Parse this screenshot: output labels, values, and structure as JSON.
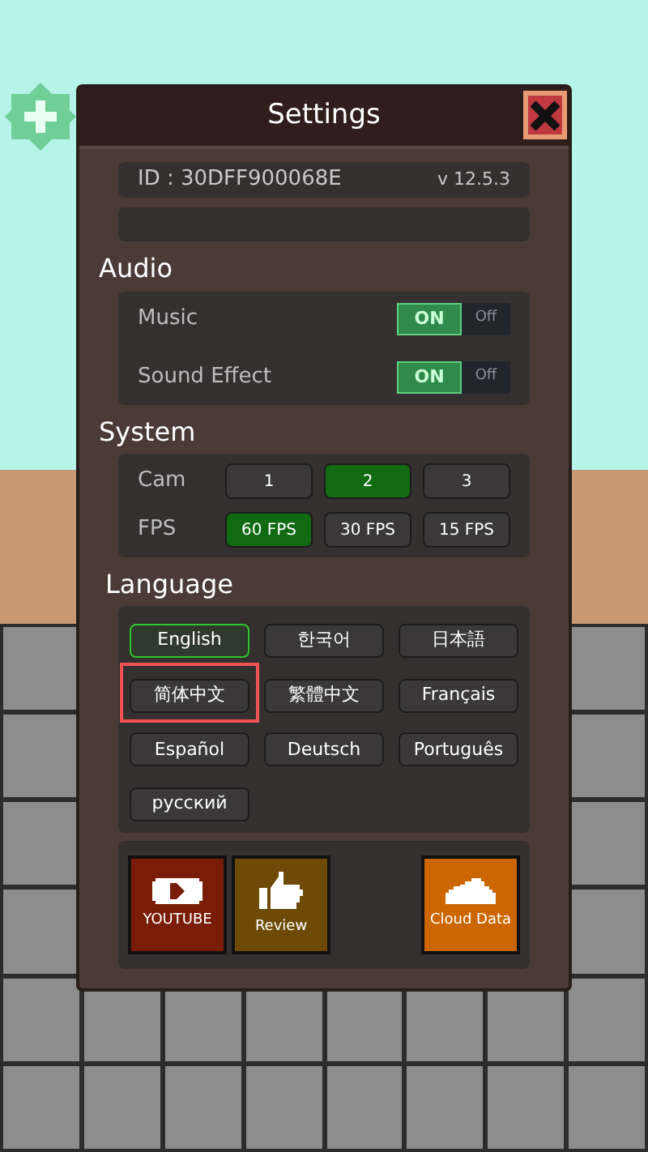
{
  "window": {
    "title": "Settings"
  },
  "account": {
    "id": "ID : 30DFF900068E",
    "version": "v 12.5.3"
  },
  "audio": {
    "heading": "Audio",
    "toggles": [
      {
        "label": "Music",
        "on": true,
        "on_text": "ON",
        "off_text": "Off"
      },
      {
        "label": "Sound Effect",
        "on": true,
        "on_text": "ON",
        "off_text": "Off"
      }
    ]
  },
  "system": {
    "heading": "System",
    "rows": [
      {
        "label": "Cam",
        "options": [
          {
            "label": "1",
            "selected": false
          },
          {
            "label": "2",
            "selected": true
          },
          {
            "label": "3",
            "selected": false
          }
        ]
      },
      {
        "label": "FPS",
        "options": [
          {
            "label": "60 FPS",
            "selected": true
          },
          {
            "label": "30 FPS",
            "selected": false
          },
          {
            "label": "15 FPS",
            "selected": false
          }
        ]
      }
    ]
  },
  "language": {
    "heading": "Language",
    "options": [
      {
        "label": "English",
        "selected": true,
        "highlighted": false
      },
      {
        "label": "한국어",
        "selected": false,
        "highlighted": false
      },
      {
        "label": "日本語",
        "selected": false,
        "highlighted": false
      },
      {
        "label": "简体中文",
        "selected": false,
        "highlighted": true
      },
      {
        "label": "繁體中文",
        "selected": false,
        "highlighted": false
      },
      {
        "label": "Français",
        "selected": false,
        "highlighted": false
      },
      {
        "label": "Español",
        "selected": false,
        "highlighted": false
      },
      {
        "label": "Deutsch",
        "selected": false,
        "highlighted": false
      },
      {
        "label": "Português",
        "selected": false,
        "highlighted": false
      },
      {
        "label": "русский",
        "selected": false,
        "highlighted": false
      }
    ]
  },
  "links": [
    {
      "kind": "video",
      "label": "YOUTUBE"
    },
    {
      "kind": "review",
      "label": "Review"
    },
    {
      "kind": "cloud",
      "label": "Cloud Data"
    }
  ]
}
